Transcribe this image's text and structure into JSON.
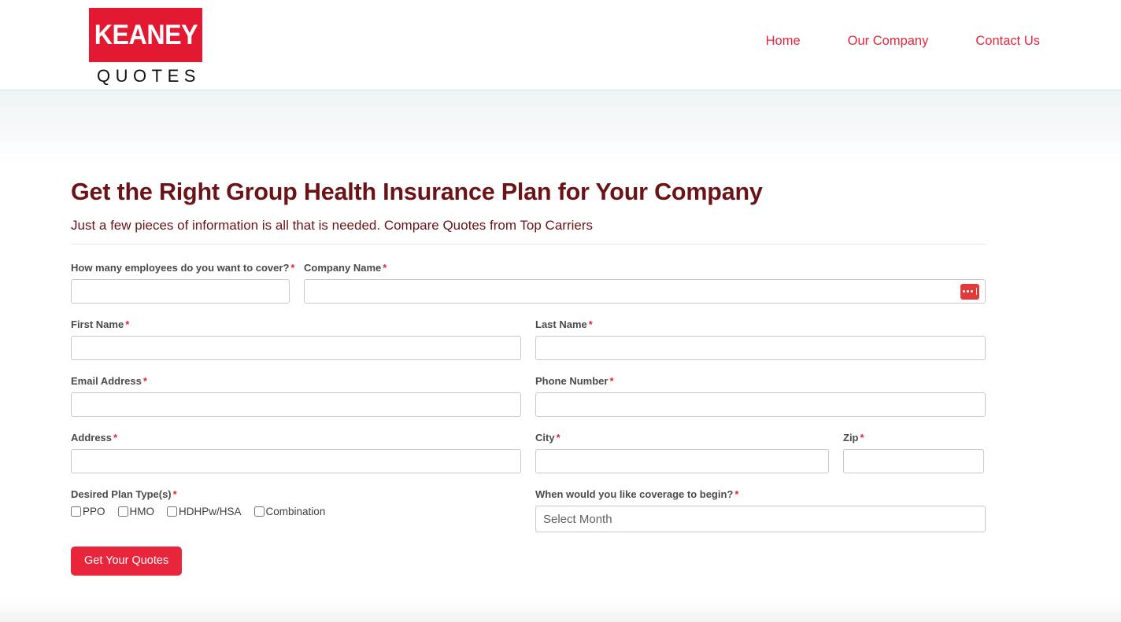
{
  "header": {
    "logo": {
      "brand": "KEANEY",
      "sub": "QUOTES"
    },
    "nav": [
      {
        "label": "Home"
      },
      {
        "label": "Our Company"
      },
      {
        "label": "Contact Us"
      }
    ]
  },
  "main": {
    "headline": "Get the Right Group Health Insurance Plan for Your Company",
    "subhead": "Just a few pieces of information is all that is needed. Compare Quotes from Top Carriers"
  },
  "form": {
    "employees": {
      "label": "How many employees do you want to cover?",
      "required": "*",
      "value": "",
      "placeholder": ""
    },
    "company": {
      "label": "Company Name",
      "required": "*",
      "value": "",
      "placeholder": "",
      "icon": "autofill-icon"
    },
    "first_name": {
      "label": "First Name",
      "required": "*",
      "value": "",
      "placeholder": ""
    },
    "last_name": {
      "label": "Last Name",
      "required": "*",
      "value": "",
      "placeholder": ""
    },
    "email": {
      "label": "Email Address",
      "required": "*",
      "value": "",
      "placeholder": ""
    },
    "phone": {
      "label": "Phone Number",
      "required": "*",
      "value": "",
      "placeholder": ""
    },
    "address": {
      "label": "Address",
      "required": "*",
      "value": "",
      "placeholder": ""
    },
    "city": {
      "label": "City",
      "required": "*",
      "value": "",
      "placeholder": ""
    },
    "zip": {
      "label": "Zip",
      "required": "*",
      "value": "",
      "placeholder": ""
    },
    "plan_types": {
      "label": "Desired Plan Type(s)",
      "required": "*",
      "options": [
        {
          "label": "PPO",
          "checked": false
        },
        {
          "label": "HMO",
          "checked": false
        },
        {
          "label": "HDHPw/HSA",
          "checked": false
        },
        {
          "label": "Combination",
          "checked": false
        }
      ]
    },
    "coverage_start": {
      "label": "When would you like coverage to begin?",
      "required": "*",
      "selected": "Select Month"
    },
    "submit_label": "Get Your Quotes"
  },
  "colors": {
    "brand_red": "#e31932",
    "accent_red": "#e8253a",
    "headline_maroon": "#6b1316",
    "label_gray": "#4a4a4a",
    "border_gray": "#c8c8c8"
  }
}
